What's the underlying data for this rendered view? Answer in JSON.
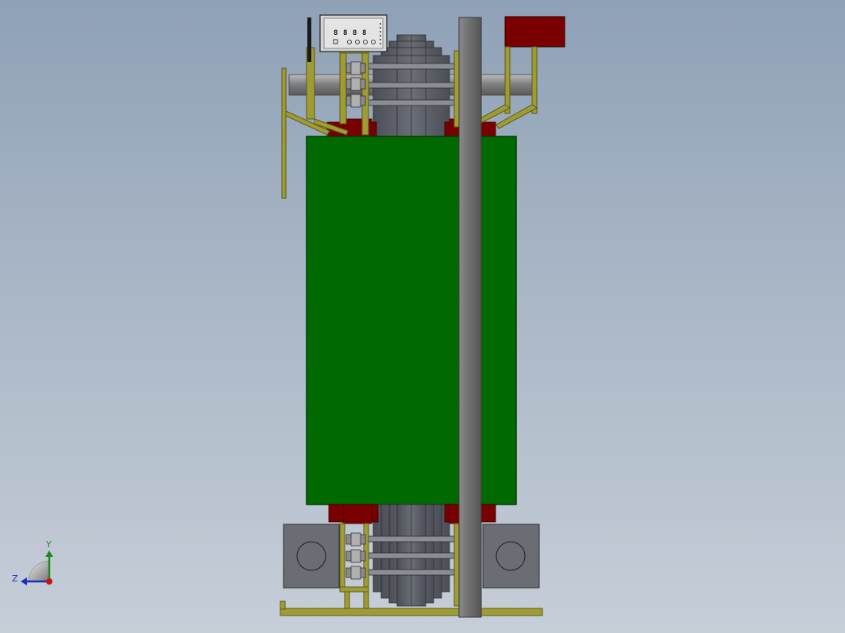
{
  "colors": {
    "background_top": "#8fa1b7",
    "background_bottom": "#c6ced8",
    "coil_green": "#006a00",
    "core_gray": "#60636b",
    "clamp_red": "#7a0000",
    "bracket_olive": "#8d8a2b",
    "pipe_gray": "#8c8c8c",
    "rod_gray": "#6f6f6f"
  },
  "display_panel": {
    "digits": [
      "8",
      "8",
      "8",
      "8"
    ]
  },
  "triad": {
    "y_label": "Y",
    "z_label": "Z"
  }
}
